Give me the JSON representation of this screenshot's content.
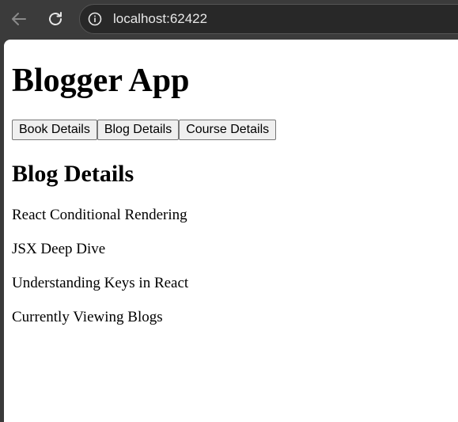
{
  "browser": {
    "url": "localhost:62422"
  },
  "app": {
    "title": "Blogger App",
    "buttons": [
      "Book Details",
      "Blog Details",
      "Course Details"
    ],
    "section_title": "Blog Details",
    "blogs": [
      "React Conditional Rendering",
      "JSX Deep Dive",
      "Understanding Keys in React"
    ],
    "status": "Currently Viewing Blogs"
  }
}
